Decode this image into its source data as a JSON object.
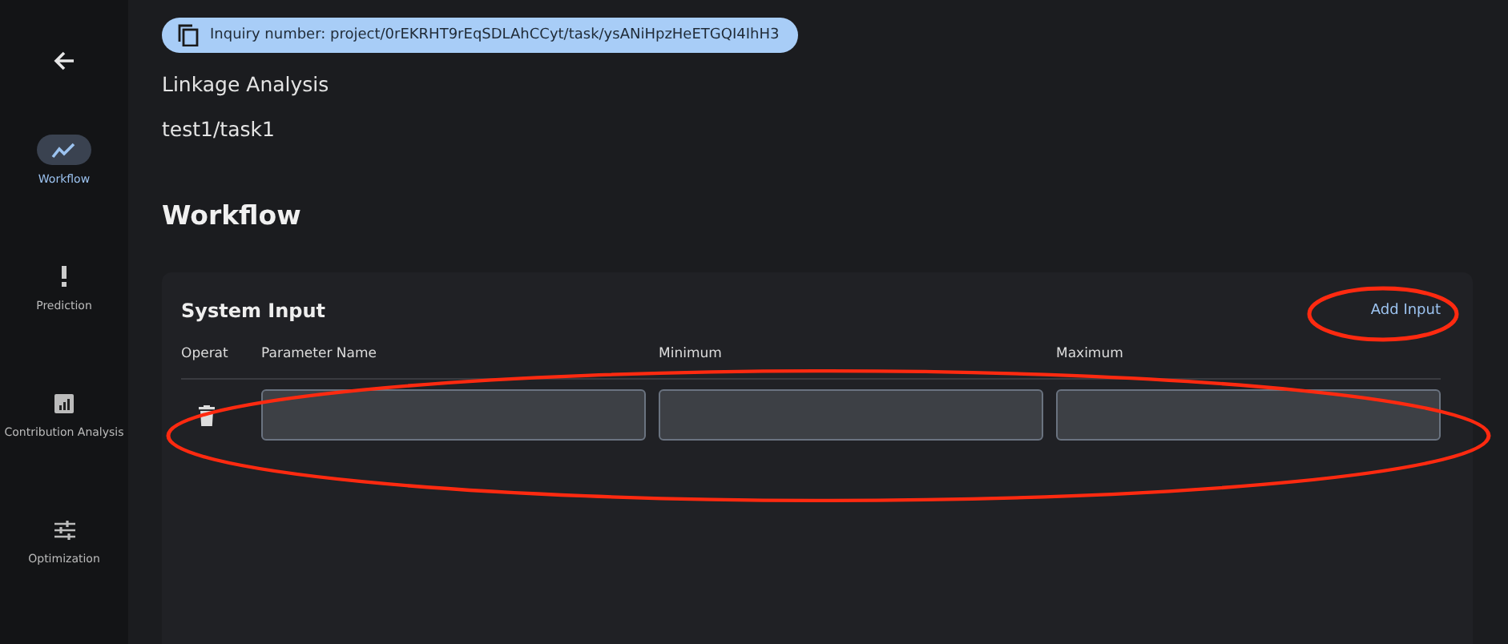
{
  "inquiry": {
    "text": "Inquiry number: project/0rEKRHT9rEqSDLAhCCyt/task/ysANiHpzHeETGQI4IhH3"
  },
  "header": {
    "title": "Linkage Analysis",
    "path": "test1/task1"
  },
  "sidebar": {
    "items": [
      {
        "kind": "workflow",
        "label": "Workflow",
        "selected": true
      },
      {
        "kind": "prediction",
        "label": "Prediction",
        "selected": false
      },
      {
        "kind": "contribution",
        "label": "Contribution Analysis",
        "selected": false
      },
      {
        "kind": "optimization",
        "label": "Optimization",
        "selected": false
      }
    ]
  },
  "section_title": "Workflow",
  "system_input": {
    "title": "System Input",
    "add_button": "Add Input",
    "columns": [
      "Operat",
      "Parameter Name",
      "Minimum",
      "Maximum"
    ],
    "rows": [
      {
        "fields": [
          {
            "kind": "text"
          },
          {
            "kind": "text"
          },
          {
            "kind": "text"
          }
        ]
      }
    ]
  },
  "annotations": [
    {
      "kind": "ellipse"
    },
    {
      "kind": "ellipse"
    }
  ]
}
